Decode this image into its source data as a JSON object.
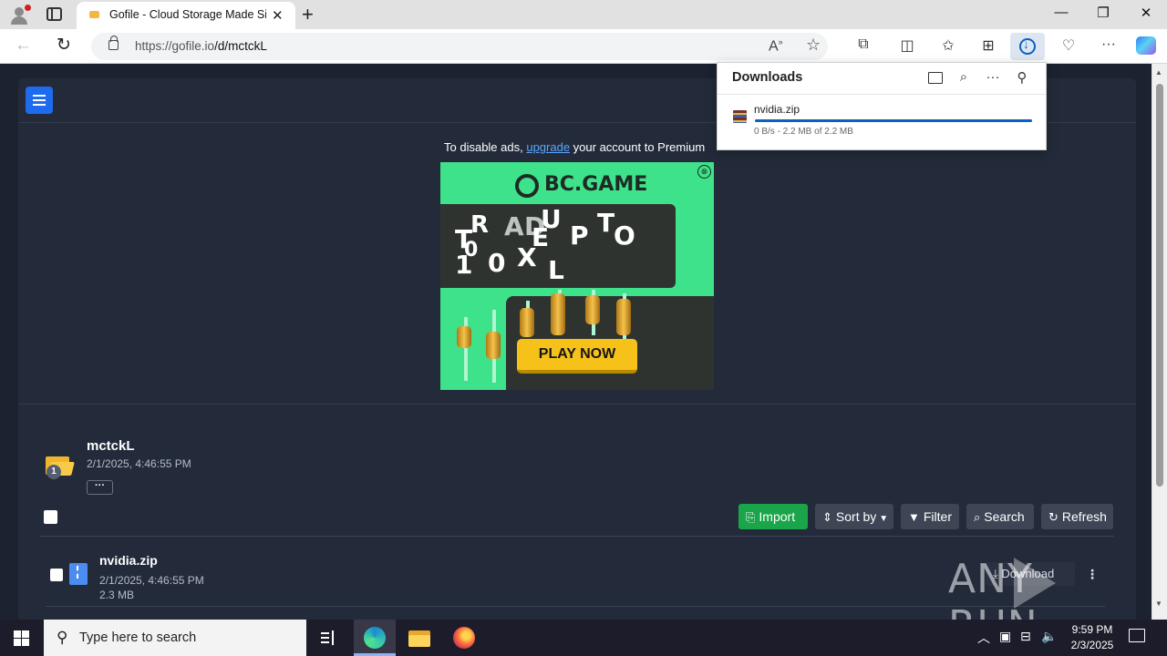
{
  "browser": {
    "tab_title": "Gofile - Cloud Storage Made Simple",
    "url_host": "https://gofile.io",
    "url_path": "/d/mctckL",
    "icons": [
      "profile-icon",
      "tab-actions-icon",
      "back-icon",
      "refresh-icon",
      "read-aloud-icon",
      "favorite-star-icon",
      "extensions-icon",
      "split-screen-icon",
      "favorites-icon",
      "collections-icon",
      "downloads-icon",
      "browser-essentials-icon",
      "more-icon",
      "copilot-icon"
    ]
  },
  "downloads_panel": {
    "title": "Downloads",
    "item": {
      "filename": "nvidia.zip",
      "status": "0 B/s - 2.2 MB of 2.2 MB",
      "progress": 1.0
    }
  },
  "page": {
    "ad_notice_prefix": "To disable ads, ",
    "ad_notice_link": "upgrade",
    "ad_notice_suffix": " your account to Premium",
    "ad": {
      "brand": "BC.GAME",
      "cta": "PLAY NOW",
      "letters": [
        "T",
        "R",
        "A",
        "D",
        "U",
        "P",
        "T",
        "O",
        "E",
        "1",
        "0",
        "0",
        "X",
        "L"
      ],
      "colors": {
        "background": "#3de28a",
        "panel": "#2e3330",
        "button": "#f6c21a"
      }
    },
    "folder": {
      "name": "mctckL",
      "created": "2/1/2025, 4:46:55 PM",
      "badge_count": "1",
      "more_label": "···"
    },
    "toolbar": {
      "import_label": "Import",
      "sort_label": "Sort by",
      "filter_label": "Filter",
      "search_label": "Search",
      "refresh_label": "Refresh"
    },
    "files": [
      {
        "name": "nvidia.zip",
        "date": "2/1/2025, 4:46:55 PM",
        "size": "2.3 MB",
        "download_label": "Download",
        "menu_label": "⋮"
      }
    ],
    "watermark": "ANY RUN",
    "colors": {
      "page_bg": "#1c2230",
      "card_bg": "#232b3a",
      "accent_blue": "#1e6bf0",
      "accent_green": "#1aa54a",
      "link": "#5aa7ff"
    }
  },
  "taskbar": {
    "search_placeholder": "Type here to search",
    "time": "9:59 PM",
    "date": "2/3/2025",
    "apps": [
      "task-view-icon",
      "edge-icon",
      "file-explorer-icon",
      "firefox-icon"
    ]
  }
}
